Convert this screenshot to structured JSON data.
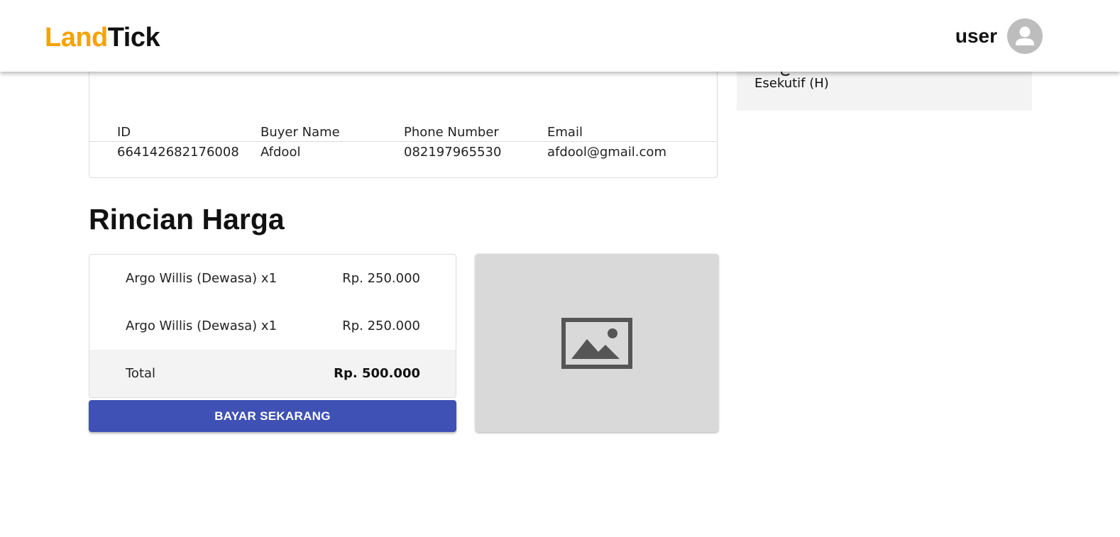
{
  "header": {
    "logo_part1": "Land",
    "logo_part2": "Tick",
    "user_name": "user",
    "avatar_icon": "account-circle-icon"
  },
  "side_card": {
    "class_value": "Esekutif (H)"
  },
  "passenger": {
    "columns": [
      "ID",
      "Buyer Name",
      "Phone Number",
      "Email"
    ],
    "rows": [
      [
        "664142682176008",
        "Afdool",
        "082197965530",
        "afdool@gmail.com"
      ]
    ]
  },
  "pricing": {
    "title": "Rincian Harga",
    "items": [
      {
        "label": "Argo Willis (Dewasa) x1",
        "value": "Rp. 250.000"
      },
      {
        "label": "Argo Willis (Dewasa) x1",
        "value": "Rp. 250.000"
      }
    ],
    "total_label": "Total",
    "total_value": "Rp. 500.000",
    "pay_button": "BAYAR SEKARANG"
  },
  "image_placeholder": {
    "icon": "image-placeholder-icon"
  },
  "colors": {
    "brand_orange": "#f5a300",
    "button_blue": "#3f51b5",
    "panel_gray": "#f3f3f3",
    "placeholder_gray": "#d9d9d9"
  }
}
